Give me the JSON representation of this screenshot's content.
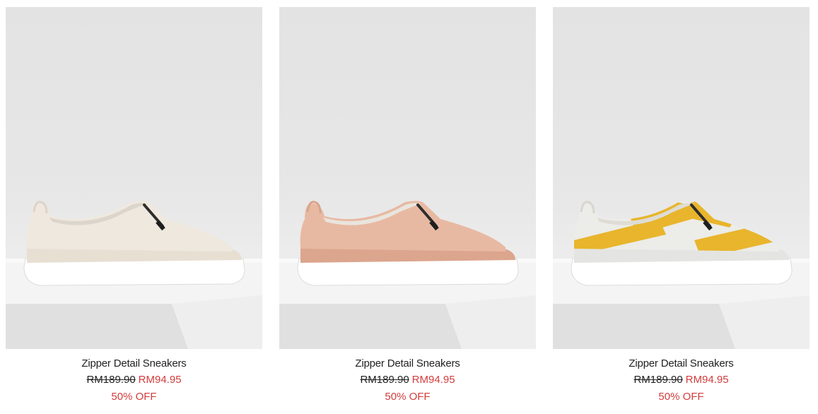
{
  "products": [
    {
      "name": "Zipper Detail Sneakers",
      "original_price": "RM189.90",
      "sale_price": "RM94.95",
      "discount": "50% OFF",
      "color": "#efe8df",
      "shoe_image": "white-slip-on-sneaker"
    },
    {
      "name": "Zipper Detail Sneakers",
      "original_price": "RM189.90",
      "sale_price": "RM94.95",
      "discount": "50% OFF",
      "color": "#e8b9a2",
      "shoe_image": "nude-slip-on-sneaker"
    },
    {
      "name": "Zipper Detail Sneakers",
      "original_price": "RM189.90",
      "sale_price": "RM94.95",
      "discount": "50% OFF",
      "color": "#e8b52c",
      "shoe_image": "yellow-stripe-slip-on-sneaker"
    }
  ],
  "colors": {
    "sale": "#d33c3c",
    "text": "#222222",
    "backdrop": "#e6e6e6"
  }
}
